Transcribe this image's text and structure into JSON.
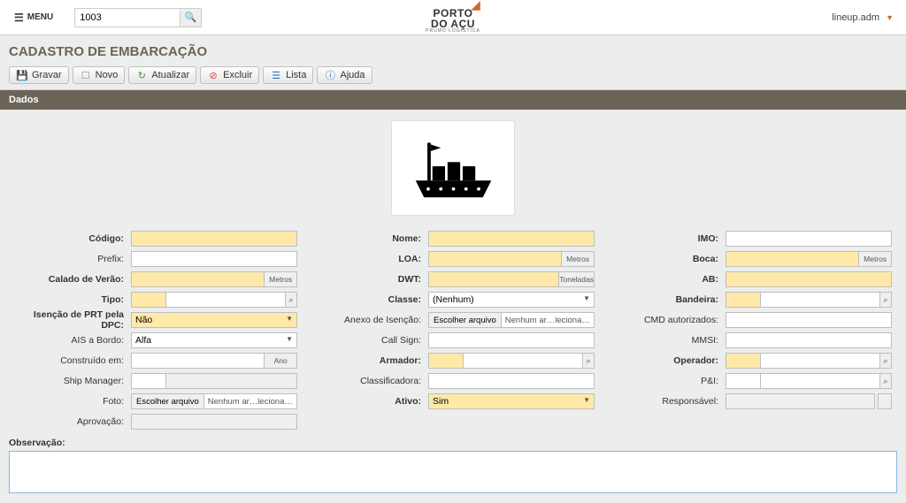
{
  "header": {
    "menu_label": "MENU",
    "search_value": "1003",
    "logo_line1": "PORTO",
    "logo_line2": "DO AÇU",
    "logo_sub": "PRUMO LOGÍSTICA",
    "user_label": "lineup.adm"
  },
  "page_title": "CADASTRO DE EMBARCAÇÃO",
  "toolbar": {
    "save": "Gravar",
    "new": "Novo",
    "refresh": "Atualizar",
    "delete": "Excluir",
    "list": "Lista",
    "help": "Ajuda"
  },
  "section_title": "Dados",
  "labels": {
    "codigo": "Código:",
    "prefix": "Prefix:",
    "calado": "Calado de Verão:",
    "tipo": "Tipo:",
    "isencao": "Isenção de PRT pela DPC:",
    "ais": "AIS a Bordo:",
    "construido": "Construído em:",
    "shipmgr": "Ship Manager:",
    "foto": "Foto:",
    "aprovacao": "Aprovação:",
    "nome": "Nome:",
    "loa": "LOA:",
    "dwt": "DWT:",
    "classe": "Classe:",
    "anexo": "Anexo de Isenção:",
    "callsign": "Call Sign:",
    "armador": "Armador:",
    "classificadora": "Classificadora:",
    "ativo": "Ativo:",
    "imo": "IMO:",
    "boca": "Boca:",
    "ab": "AB:",
    "bandeira": "Bandeira:",
    "cmd": "CMD autorizados:",
    "mmsi": "MMSI:",
    "operador": "Operador:",
    "pi": "P&I:",
    "responsavel": "Responsável:",
    "observacao": "Observação:"
  },
  "units": {
    "metros": "Metros",
    "toneladas": "Toneladas",
    "ano": "Ano"
  },
  "values": {
    "isencao": "Não",
    "ais": "Alfa",
    "classe": "(Nenhum)",
    "ativo": "Sim",
    "file_btn": "Escolher arquivo",
    "file_none": "Nenhum ar…lecionado",
    "file_none2": "Nenhum ar…lecionado"
  }
}
